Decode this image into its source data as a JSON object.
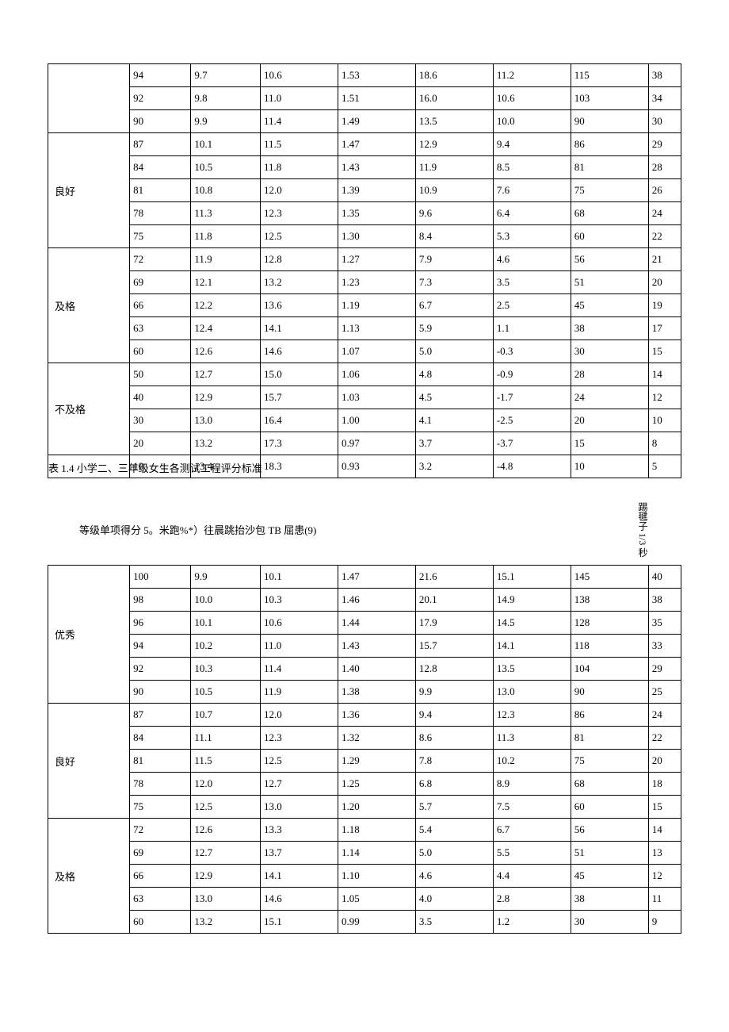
{
  "table1": {
    "groups": [
      {
        "grade": "",
        "rows": [
          [
            "94",
            "9.7",
            "10.6",
            "1.53",
            "18.6",
            "11.2",
            "115",
            "38"
          ],
          [
            "92",
            "9.8",
            "11.0",
            "1.51",
            "16.0",
            "10.6",
            "103",
            "34"
          ],
          [
            "90",
            "9.9",
            "11.4",
            "1.49",
            "13.5",
            "10.0",
            "90",
            "30"
          ]
        ]
      },
      {
        "grade": "良好",
        "rows": [
          [
            "87",
            "10.1",
            "11.5",
            "1.47",
            "12.9",
            "9.4",
            "86",
            "29"
          ],
          [
            "84",
            "10.5",
            "11.8",
            "1.43",
            "11.9",
            "8.5",
            "81",
            "28"
          ],
          [
            "81",
            "10.8",
            "12.0",
            "1.39",
            "10.9",
            "7.6",
            "75",
            "26"
          ],
          [
            "78",
            "11.3",
            "12.3",
            "1.35",
            "9.6",
            "6.4",
            "68",
            "24"
          ],
          [
            "75",
            "11.8",
            "12.5",
            "1.30",
            "8.4",
            "5.3",
            "60",
            "22"
          ]
        ]
      },
      {
        "grade": "及格",
        "rows": [
          [
            "72",
            "11.9",
            "12.8",
            "1.27",
            "7.9",
            "4.6",
            "56",
            "21"
          ],
          [
            "69",
            "12.1",
            "13.2",
            "1.23",
            "7.3",
            "3.5",
            "51",
            "20"
          ],
          [
            "66",
            "12.2",
            "13.6",
            "1.19",
            "6.7",
            "2.5",
            "45",
            "19"
          ],
          [
            "63",
            "12.4",
            "14.1",
            "1.13",
            "5.9",
            "1.1",
            "38",
            "17"
          ],
          [
            "60",
            "12.6",
            "14.6",
            "1.07",
            "5.0",
            "-0.3",
            "30",
            "15"
          ]
        ]
      },
      {
        "grade": "不及格",
        "rows": [
          [
            "50",
            "12.7",
            "15.0",
            "1.06",
            "4.8",
            "-0.9",
            "28",
            "14"
          ],
          [
            "40",
            "12.9",
            "15.7",
            "1.03",
            "4.5",
            "-1.7",
            "24",
            "12"
          ],
          [
            "30",
            "13.0",
            "16.4",
            "1.00",
            "4.1",
            "-2.5",
            "20",
            "10"
          ],
          [
            "20",
            "13.2",
            "17.3",
            "0.97",
            "3.7",
            "-3.7",
            "15",
            "8"
          ]
        ]
      }
    ],
    "caption_row": {
      "caption": "表 1.4 小学二、三年级女生各测试工程评分标准",
      "cells": [
        "10",
        "13.4",
        "18.3",
        "0.93",
        "3.2",
        "-4.8",
        "10",
        "5"
      ]
    }
  },
  "header2": {
    "left": "等级单项得分 5。米跑%*）往晨跳抬沙包 TB 屈患(9)",
    "right": "踢毽子 1/3 秒"
  },
  "table2": {
    "groups": [
      {
        "grade": "优秀",
        "rows": [
          [
            "100",
            "9.9",
            "10.1",
            "1.47",
            "21.6",
            "15.1",
            "145",
            "40"
          ],
          [
            "98",
            "10.0",
            "10.3",
            "1.46",
            "20.1",
            "14.9",
            "138",
            "38"
          ],
          [
            "96",
            "10.1",
            "10.6",
            "1.44",
            "17.9",
            "14.5",
            "128",
            "35"
          ],
          [
            "94",
            "10.2",
            "11.0",
            "1.43",
            "15.7",
            "14.1",
            "118",
            "33"
          ],
          [
            "92",
            "10.3",
            "11.4",
            "1.40",
            "12.8",
            "13.5",
            "104",
            "29"
          ],
          [
            "90",
            "10.5",
            "11.9",
            "1.38",
            "9.9",
            "13.0",
            "90",
            "25"
          ]
        ]
      },
      {
        "grade": "良好",
        "rows": [
          [
            "87",
            "10.7",
            "12.0",
            "1.36",
            "9.4",
            "12.3",
            "86",
            "24"
          ],
          [
            "84",
            "11.1",
            "12.3",
            "1.32",
            "8.6",
            "11.3",
            "81",
            "22"
          ],
          [
            "81",
            "11.5",
            "12.5",
            "1.29",
            "7.8",
            "10.2",
            "75",
            "20"
          ],
          [
            "78",
            "12.0",
            "12.7",
            "1.25",
            "6.8",
            "8.9",
            "68",
            "18"
          ],
          [
            "75",
            "12.5",
            "13.0",
            "1.20",
            "5.7",
            "7.5",
            "60",
            "15"
          ]
        ]
      },
      {
        "grade": "及格",
        "rows": [
          [
            "72",
            "12.6",
            "13.3",
            "1.18",
            "5.4",
            "6.7",
            "56",
            "14"
          ],
          [
            "69",
            "12.7",
            "13.7",
            "1.14",
            "5.0",
            "5.5",
            "51",
            "13"
          ],
          [
            "66",
            "12.9",
            "14.1",
            "1.10",
            "4.6",
            "4.4",
            "45",
            "12"
          ],
          [
            "63",
            "13.0",
            "14.6",
            "1.05",
            "4.0",
            "2.8",
            "38",
            "11"
          ],
          [
            "60",
            "13.2",
            "15.1",
            "0.99",
            "3.5",
            "1.2",
            "30",
            "9"
          ]
        ]
      }
    ]
  }
}
